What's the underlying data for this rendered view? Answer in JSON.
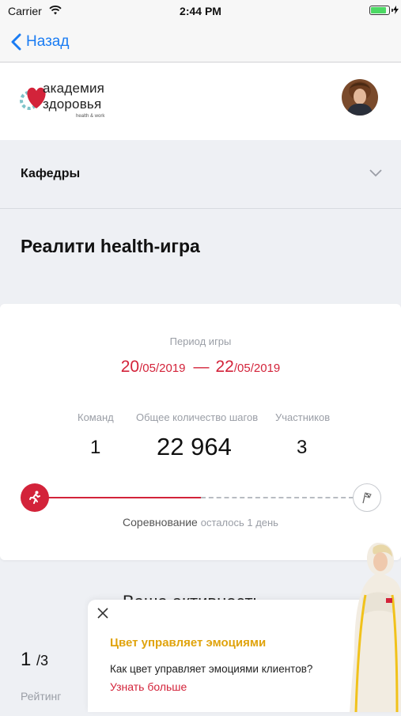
{
  "status_bar": {
    "carrier": "Carrier",
    "time": "2:44 PM",
    "battery_level": 0.9
  },
  "nav": {
    "back_label": "Назад"
  },
  "header": {
    "logo_line1": "академия",
    "logo_line2": "здоровья",
    "logo_sub": "health & work"
  },
  "departments": {
    "label": "Кафедры"
  },
  "page": {
    "title": "Реалити health-игра"
  },
  "game": {
    "period_label": "Период игры",
    "start_day": "20",
    "start_rest": "/05/2019",
    "dash": "—",
    "end_day": "22",
    "end_rest": "/05/2019",
    "teams_label": "Команд",
    "teams_value": "1",
    "steps_label": "Общее количество шагов",
    "steps_value": "22 964",
    "participants_label": "Участников",
    "participants_value": "3",
    "progress_fraction": 0.52,
    "status_main": "Соревнование",
    "status_remaining": "осталось 1 день"
  },
  "activity": {
    "title": "Ваша активность",
    "rank": "1",
    "rank_total": "/3",
    "rank_label": "Рейтинг"
  },
  "promo": {
    "title": "Цвет управляет эмоциями",
    "text": "Как цвет управляет эмоциями клиентов?",
    "link": "Узнать больше"
  },
  "colors": {
    "accent": "#d3233a",
    "link_blue": "#1a7cf3",
    "promo_title": "#e0a30c"
  }
}
